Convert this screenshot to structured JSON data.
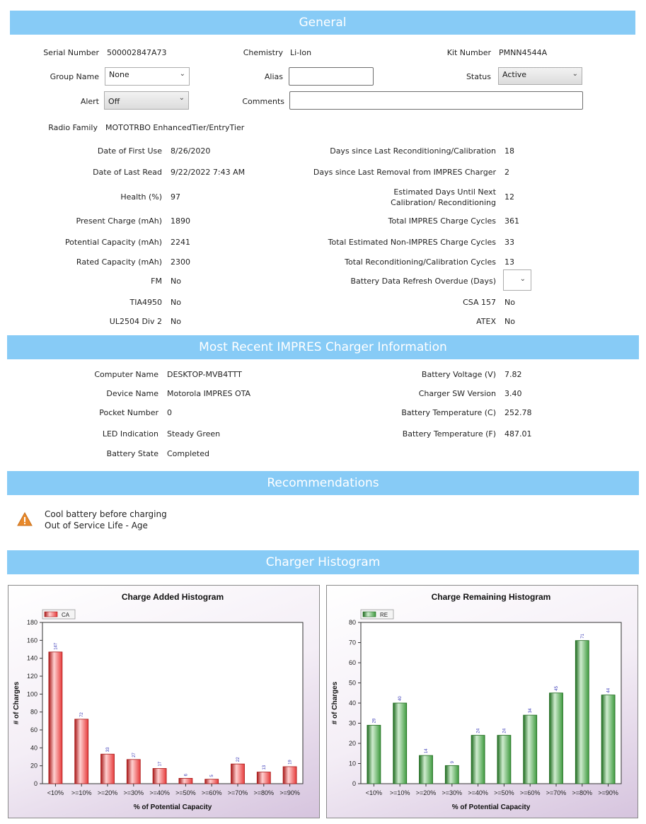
{
  "sections": {
    "general": "General",
    "charger_info": "Most Recent IMPRES Charger Information",
    "recommendations": "Recommendations",
    "histogram": "Charger Histogram"
  },
  "general": {
    "serial_number_label": "Serial Number",
    "serial_number": "500002847A73",
    "chemistry_label": "Chemistry",
    "chemistry": "Li-Ion",
    "kit_number_label": "Kit Number",
    "kit_number": "PMNN4544A",
    "group_name_label": "Group Name",
    "group_name": "None",
    "alias_label": "Alias",
    "alias": "",
    "status_label": "Status",
    "status": "Active",
    "alert_label": "Alert",
    "alert": "Off",
    "comments_label": "Comments",
    "comments": "",
    "radio_family_label": "Radio Family",
    "radio_family": "MOTOTRBO EnhancedTier/EntryTier"
  },
  "details_left": [
    {
      "label": "Date of First Use",
      "value": "8/26/2020"
    },
    {
      "label": "Date of Last Read",
      "value": "9/22/2022 7:43 AM"
    },
    {
      "label": "Health (%)",
      "value": "97"
    },
    {
      "label": "Present Charge (mAh)",
      "value": "1890"
    },
    {
      "label": "Potential Capacity (mAh)",
      "value": "2241"
    },
    {
      "label": "Rated Capacity (mAh)",
      "value": "2300"
    },
    {
      "label": "FM",
      "value": "No"
    },
    {
      "label": "TIA4950",
      "value": "No"
    },
    {
      "label": "UL2504 Div 2",
      "value": "No"
    }
  ],
  "details_right": [
    {
      "label": "Days since Last Reconditioning/Calibration",
      "value": "18"
    },
    {
      "label": "Days since Last Removal from IMPRES Charger",
      "value": "2"
    },
    {
      "label": "Estimated Days Until Next Calibration/ Reconditioning",
      "value": "12"
    },
    {
      "label": "Total IMPRES Charge Cycles",
      "value": "361"
    },
    {
      "label": "Total Estimated Non-IMPRES Charge Cycles",
      "value": "33"
    },
    {
      "label": "Total Reconditioning/Calibration Cycles",
      "value": "13"
    },
    {
      "label": "Battery Data Refresh Overdue (Days)",
      "value": ""
    },
    {
      "label": "CSA 157",
      "value": "No"
    },
    {
      "label": "ATEX",
      "value": "No"
    }
  ],
  "charger_left": [
    {
      "label": "Computer Name",
      "value": "DESKTOP-MVB4TTT"
    },
    {
      "label": "Device Name",
      "value": "Motorola IMPRES OTA"
    },
    {
      "label": "Pocket Number",
      "value": "0"
    },
    {
      "label": "LED Indication",
      "value": "Steady Green"
    },
    {
      "label": "Battery State",
      "value": "Completed"
    }
  ],
  "charger_right": [
    {
      "label": "Battery Voltage (V)",
      "value": "7.82"
    },
    {
      "label": "Charger SW Version",
      "value": "3.40"
    },
    {
      "label": "Battery Temperature (C)",
      "value": "252.78"
    },
    {
      "label": "Battery Temperature (F)",
      "value": "487.01"
    }
  ],
  "recommendations": {
    "icon": "warning-icon",
    "lines": [
      "Cool battery before charging",
      "Out of Service Life - Age"
    ]
  },
  "colors": {
    "band": "#87cbf6",
    "ca_bar": "#e63b3b",
    "re_bar": "#3f9a3f",
    "warning": "#e8892b"
  },
  "chart_data": [
    {
      "type": "bar",
      "title": "Charge Added Histogram",
      "xlabel": "% of Potential Capacity",
      "ylabel": "# of Charges",
      "categories": [
        "<10%",
        ">=10%",
        ">=20%",
        ">=30%",
        ">=40%",
        ">=50%",
        ">=60%",
        ">=70%",
        ">=80%",
        ">=90%"
      ],
      "series": [
        {
          "name": "CA",
          "values": [
            147,
            72,
            33,
            27,
            17,
            6,
            5,
            22,
            13,
            19
          ]
        }
      ],
      "ylim": [
        0,
        180
      ],
      "yticks": [
        0,
        20,
        40,
        60,
        80,
        100,
        120,
        140,
        160,
        180
      ],
      "grid": false,
      "legend": "top-left"
    },
    {
      "type": "bar",
      "title": "Charge Remaining Histogram",
      "xlabel": "% of Potential Capacity",
      "ylabel": "# of Charges",
      "categories": [
        "<10%",
        ">=10%",
        ">=20%",
        ">=30%",
        ">=40%",
        ">=50%",
        ">=60%",
        ">=70%",
        ">=80%",
        ">=90%"
      ],
      "series": [
        {
          "name": "RE",
          "values": [
            29,
            40,
            14,
            9,
            24,
            24,
            34,
            45,
            71,
            44
          ]
        }
      ],
      "ylim": [
        0,
        80
      ],
      "yticks": [
        0,
        10,
        20,
        30,
        40,
        50,
        60,
        70,
        80
      ],
      "grid": false,
      "legend": "top-left"
    }
  ]
}
